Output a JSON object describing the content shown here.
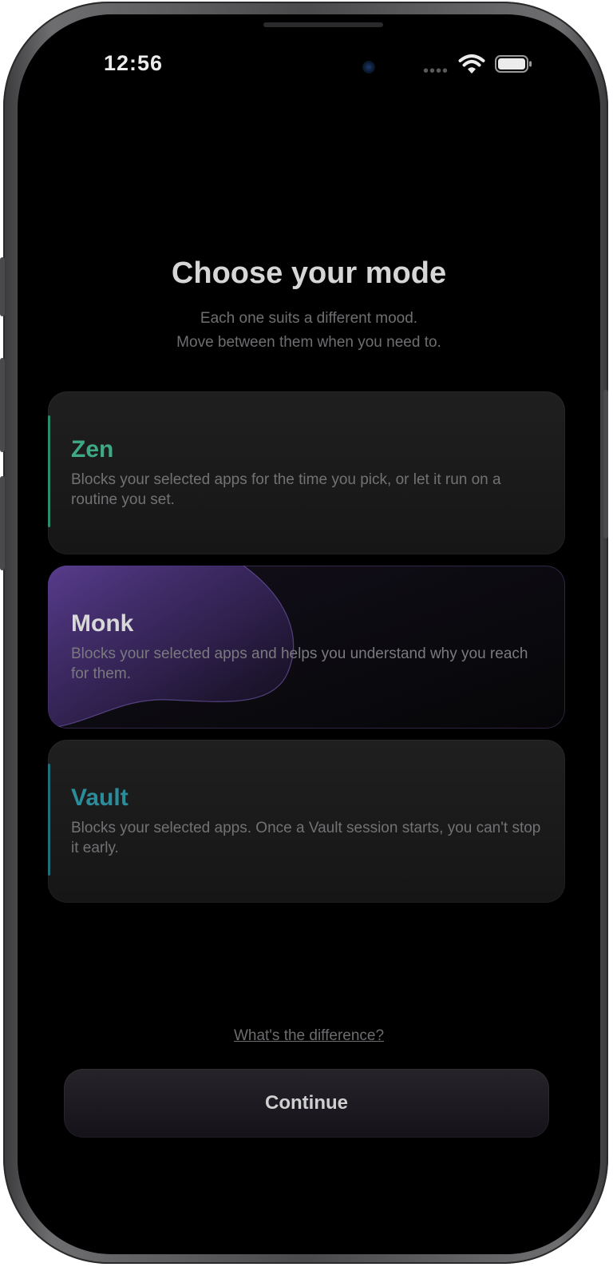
{
  "status_bar": {
    "time": "12:56",
    "signal_icon": "cellular-dots-icon",
    "wifi_icon": "wifi-icon",
    "battery_icon": "battery-icon"
  },
  "header": {
    "title": "Choose your mode",
    "subtitle_line1": "Each one suits a different mood.",
    "subtitle_line2": "Move between them when you need to."
  },
  "modes": [
    {
      "name": "Zen",
      "description": "Blocks your selected apps for the time you pick, or let it run on a routine you set.",
      "color": "#3fa886"
    },
    {
      "name": "Monk",
      "description": "Blocks your selected apps and helps you understand why you reach for them.",
      "color": "#d8d8d8",
      "accent": "#5a3f8c",
      "selected": true
    },
    {
      "name": "Vault",
      "description": "Blocks your selected apps. Once a Vault session starts, you can't stop it early.",
      "color": "#2b8d9c"
    }
  ],
  "footer": {
    "difference_link": "What's the difference?",
    "continue_label": "Continue"
  }
}
